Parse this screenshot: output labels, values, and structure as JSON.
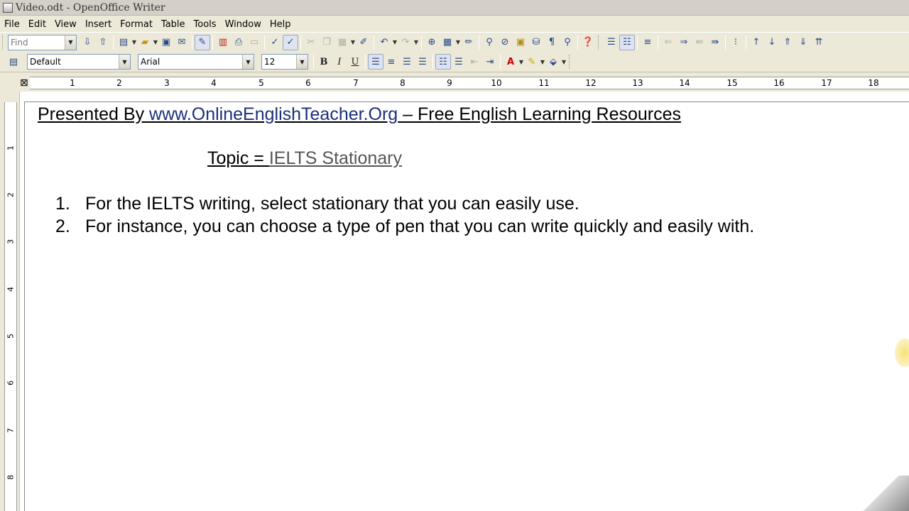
{
  "window": {
    "title": "Video.odt - OpenOffice Writer"
  },
  "menu": [
    "File",
    "Edit",
    "View",
    "Insert",
    "Format",
    "Table",
    "Tools",
    "Window",
    "Help"
  ],
  "toolbar": {
    "find_placeholder": "Find",
    "style_value": "Default",
    "font_value": "Arial",
    "size_value": "12",
    "bold": "B",
    "italic": "I",
    "underline": "U"
  },
  "ruler": {
    "numbers": [
      "1",
      "2",
      "3",
      "4",
      "5",
      "6",
      "7",
      "8",
      "9",
      "10",
      "11",
      "12",
      "13",
      "14",
      "15",
      "16",
      "17",
      "18"
    ]
  },
  "vruler": {
    "numbers": [
      "1",
      "2",
      "3",
      "4",
      "5",
      "6",
      "7",
      "8"
    ]
  },
  "document": {
    "line1_prefix": "Presented By ",
    "line1_link": "www.OnlineEnglishTeacher.Org",
    "line1_suffix": " – Free English Learning Resources",
    "topic_label": "Topic = ",
    "topic_value": "IELTS Stationary",
    "items": [
      {
        "num": "1.",
        "text": "For the IELTS writing, select stationary that you can easily use."
      },
      {
        "num": "2.",
        "text": "For instance, you can choose a type of pen that you can write quickly and easily with."
      }
    ]
  }
}
